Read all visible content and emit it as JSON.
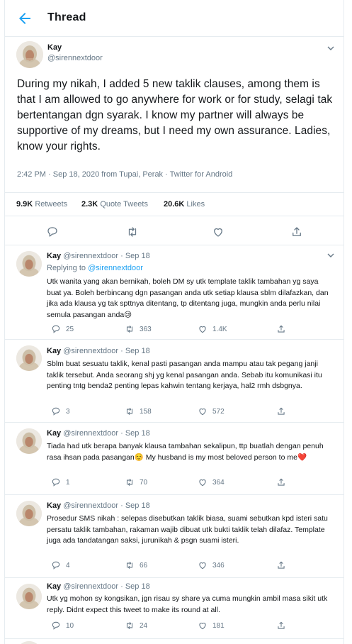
{
  "header": {
    "title": "Thread"
  },
  "main_tweet": {
    "name": "Kay",
    "handle": "@sirennextdoor",
    "text": "During my nikah, I added 5 new taklik clauses, among them is that I am allowed to go anywhere for work or for study, selagi tak bertentangan dgn syarak. I know my partner will always be supportive of my dreams, but I need my own assurance. Ladies, know your rights.",
    "meta": "2:42 PM · Sep 18, 2020 from Tupai, Perak · Twitter for Android",
    "stats": {
      "retweets_count": "9.9K",
      "retweets_label": "Retweets",
      "quotes_count": "2.3K",
      "quotes_label": "Quote Tweets",
      "likes_count": "20.6K",
      "likes_label": "Likes"
    }
  },
  "replies": [
    {
      "header": "Kay @sirennextdoor · Sep 18",
      "name": "Kay",
      "handle_date": "@sirennextdoor · Sep 18",
      "replying_label": "Replying to ",
      "replying_handle": "@sirennextdoor",
      "text": "Utk wanita yang akan bernikah, boleh DM sy utk template taklik tambahan yg saya buat ya. Boleh berbincang dgn pasangan anda utk setiap klausa sblm dilafazkan, dan jika ada klausa yg tak spttnya ditentang, tp ditentang juga, mungkin anda perlu nilai semula pasangan anda😢",
      "replies": "25",
      "retweets": "363",
      "likes": "1.4K"
    },
    {
      "name": "Kay",
      "handle_date": "@sirennextdoor · Sep 18",
      "text": "Sblm buat sesuatu taklik, kenal pasti pasangan anda mampu atau tak pegang janji taklik tersebut. Anda seorang shj yg kenal pasangan anda. Sebab itu komunikasi itu penting tntg benda2 penting lepas kahwin tentang kerjaya, hal2 rmh dsbgnya.",
      "replies": "3",
      "retweets": "158",
      "likes": "572"
    },
    {
      "name": "Kay",
      "handle_date": "@sirennextdoor · Sep 18",
      "text": "Tiada had utk berapa banyak klausa tambahan sekalipun, ttp buatlah dengan penuh rasa ihsan pada pasangan☺️ My husband is my most beloved person to me❤️",
      "replies": "1",
      "retweets": "70",
      "likes": "364"
    },
    {
      "name": "Kay",
      "handle_date": "@sirennextdoor · Sep 18",
      "text": "Prosedur SMS nikah : selepas disebutkan taklik biasa, suami sebutkan kpd isteri satu persatu taklik tambahan, rakaman wajib dibuat utk bukti taklik telah dilafaz. Template juga ada tandatangan saksi, jurunikah & psgn suami isteri.",
      "replies": "4",
      "retweets": "66",
      "likes": "346"
    },
    {
      "name": "Kay",
      "handle_date": "@sirennextdoor · Sep 18",
      "text": "Utk yg mohon sy kongsikan, jgn risau sy share ya cuma mungkin ambil masa sikit utk reply. Didnt expect this tweet to make its round at all.",
      "replies": "10",
      "retweets": "24",
      "likes": "181"
    }
  ],
  "colors": {
    "accent": "#1da1f2",
    "secondary_text": "#657786",
    "border": "#e6ecf0"
  }
}
